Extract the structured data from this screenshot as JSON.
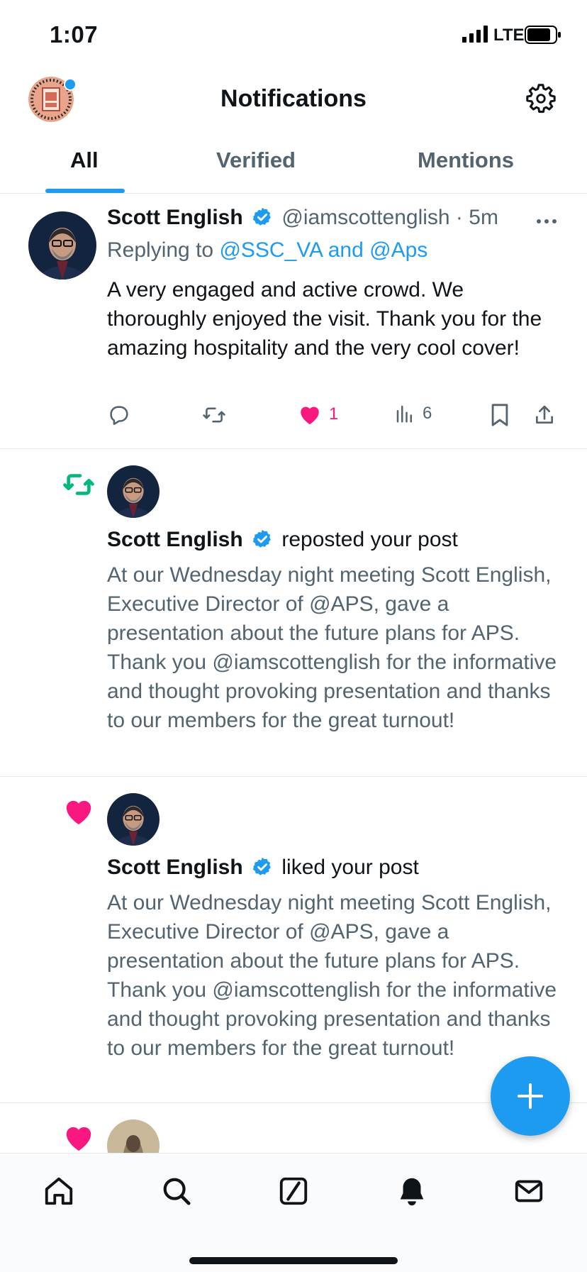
{
  "status": {
    "time": "1:07",
    "network": "LTE"
  },
  "header": {
    "title": "Notifications"
  },
  "tabs": [
    {
      "label": "All",
      "active": true
    },
    {
      "label": "Verified",
      "active": false
    },
    {
      "label": "Mentions",
      "active": false
    }
  ],
  "notifications": [
    {
      "type": "reply",
      "author": "Scott English",
      "handle": "@iamscottenglish",
      "time": "5m",
      "replying_prefix": "Replying to",
      "replying_to": "@SSC_VA and @Aps",
      "text": "A very engaged and active crowd. We thoroughly enjoyed the visit. Thank you for the amazing hospitality and the very cool cover!",
      "likes": "1",
      "views": "6"
    },
    {
      "type": "repost",
      "author": "Scott English",
      "action": "reposted your post",
      "text": "At our Wednesday night meeting Scott English, Executive Director of @APS, gave a presentation about the future plans for APS. Thank you  @iamscottenglish for the informative and thought provoking presentation and thanks to our members for the great turnout!"
    },
    {
      "type": "like",
      "author": "Scott English",
      "action": "liked your post",
      "text": "At our Wednesday night meeting Scott English, Executive Director of @APS, gave a presentation about the future plans for APS. Thank you  @iamscottenglish for the informative and thought provoking presentation and thanks to our members for the great turnout!"
    }
  ],
  "colors": {
    "accent": "#1d9bf0",
    "like": "#f91880",
    "repost": "#00ba7c",
    "text": "#0f1419",
    "muted": "#536471"
  },
  "nav_icons": [
    "home-icon",
    "search-icon",
    "grok-icon",
    "notifications-icon",
    "messages-icon"
  ]
}
